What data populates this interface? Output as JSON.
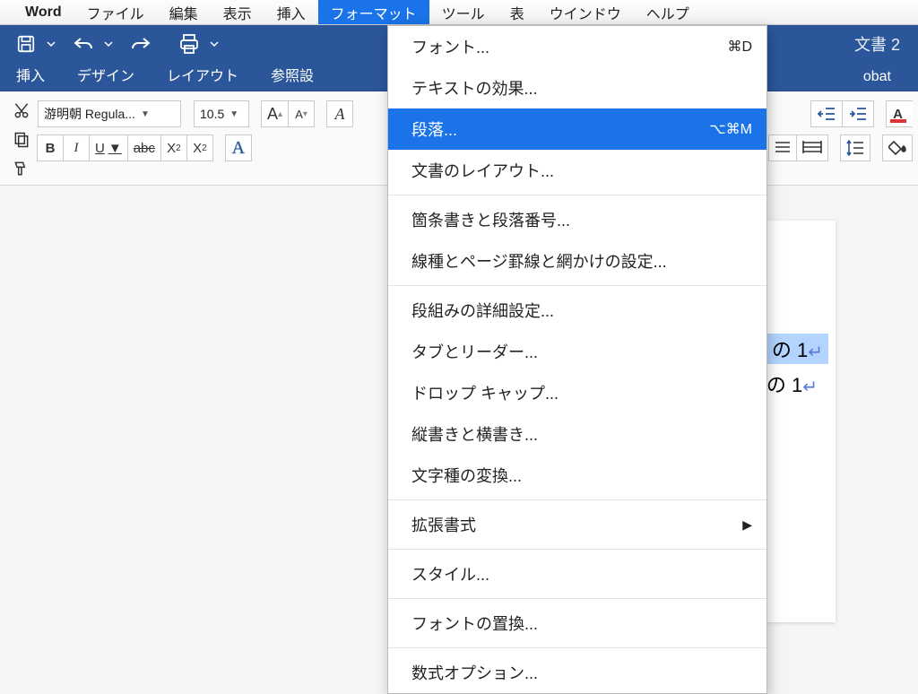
{
  "menubar": {
    "app": "Word",
    "items": [
      "ファイル",
      "編集",
      "表示",
      "挿入",
      "フォーマット",
      "ツール",
      "表",
      "ウインドウ",
      "ヘルプ"
    ],
    "selected_index": 4
  },
  "window": {
    "title": "文書 2"
  },
  "tabs": [
    "挿入",
    "デザイン",
    "レイアウト",
    "参照設",
    "obat"
  ],
  "toolbar": {
    "font_name": "游明朝 Regula...",
    "font_size": "10.5",
    "buttons": [
      "B",
      "I",
      "U",
      "abc",
      "X₂",
      "X²"
    ],
    "bigA": "A",
    "smallA": "A",
    "highlighted_A": "A"
  },
  "dropdown": {
    "groups": [
      [
        {
          "label": "フォント...",
          "shortcut": "⌘D"
        },
        {
          "label": "テキストの効果..."
        },
        {
          "label": "段落...",
          "shortcut": "⌥⌘M",
          "selected": true
        },
        {
          "label": "文書のレイアウト..."
        }
      ],
      [
        {
          "label": "箇条書きと段落番号..."
        },
        {
          "label": "線種とページ罫線と網かけの設定..."
        }
      ],
      [
        {
          "label": "段組みの詳細設定..."
        },
        {
          "label": "タブとリーダー..."
        },
        {
          "label": "ドロップ キャップ..."
        },
        {
          "label": "縦書きと横書き..."
        },
        {
          "label": "文字種の変換..."
        }
      ],
      [
        {
          "label": "拡張書式",
          "submenu": true
        }
      ],
      [
        {
          "label": "スタイル..."
        }
      ],
      [
        {
          "label": "フォントの置換..."
        }
      ],
      [
        {
          "label": "数式オプション..."
        }
      ]
    ]
  },
  "doc": {
    "line1": "の 1",
    "line2": "の 1"
  }
}
